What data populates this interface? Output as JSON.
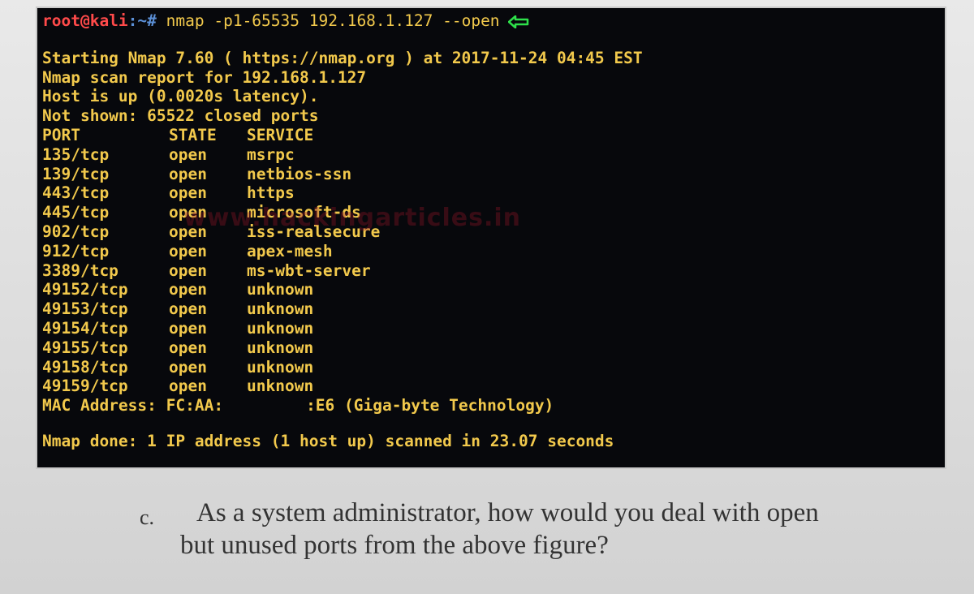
{
  "terminal": {
    "prompt_user": "root@kali",
    "prompt_path": ":~#",
    "command": " nmap -p1-65535 192.168.1.127 --open",
    "arrow_icon": "green-left-arrow-icon",
    "output_lines": [
      "Starting Nmap 7.60 ( https://nmap.org ) at 2017-11-24 04:45 EST",
      "Nmap scan report for 192.168.1.127",
      "Host is up (0.0020s latency).",
      "Not shown: 65522 closed ports"
    ],
    "table_headers": [
      "PORT",
      "STATE",
      "SERVICE"
    ],
    "ports": [
      {
        "port": "135/tcp",
        "state": "open",
        "service": "msrpc"
      },
      {
        "port": "139/tcp",
        "state": "open",
        "service": "netbios-ssn"
      },
      {
        "port": "443/tcp",
        "state": "open",
        "service": "https"
      },
      {
        "port": "445/tcp",
        "state": "open",
        "service": "microsoft-ds"
      },
      {
        "port": "902/tcp",
        "state": "open",
        "service": "iss-realsecure"
      },
      {
        "port": "912/tcp",
        "state": "open",
        "service": "apex-mesh"
      },
      {
        "port": "3389/tcp",
        "state": "open",
        "service": "ms-wbt-server"
      },
      {
        "port": "49152/tcp",
        "state": "open",
        "service": "unknown"
      },
      {
        "port": "49153/tcp",
        "state": "open",
        "service": "unknown"
      },
      {
        "port": "49154/tcp",
        "state": "open",
        "service": "unknown"
      },
      {
        "port": "49155/tcp",
        "state": "open",
        "service": "unknown"
      },
      {
        "port": "49158/tcp",
        "state": "open",
        "service": "unknown"
      },
      {
        "port": "49159/tcp",
        "state": "open",
        "service": "unknown"
      }
    ],
    "mac_line_prefix": "MAC Address: FC:AA:",
    "mac_line_suffix": ":E6 (Giga-byte Technology)",
    "done_line": "Nmap done: 1 IP address (1 host up) scanned in 23.07 seconds"
  },
  "watermark": "www.hackingarticles.in",
  "question": {
    "letter": "c.",
    "line1": "As a system administrator, how would you deal with open",
    "line2": "but unused ports from the above figure?"
  }
}
